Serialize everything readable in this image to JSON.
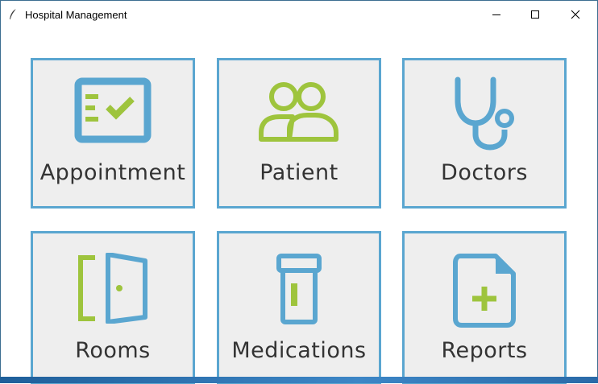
{
  "window": {
    "title": "Hospital Management",
    "controls": [
      "minimize-icon",
      "maximize-icon",
      "close-icon"
    ]
  },
  "tiles": [
    {
      "label": "Appointment",
      "icon": "appointment-checklist-icon"
    },
    {
      "label": "Patient",
      "icon": "patients-icon"
    },
    {
      "label": "Doctors",
      "icon": "stethoscope-icon"
    },
    {
      "label": "Rooms",
      "icon": "door-icon"
    },
    {
      "label": "Medications",
      "icon": "pill-bottle-icon"
    },
    {
      "label": "Reports",
      "icon": "medical-report-icon"
    }
  ],
  "colors": {
    "tile_border": "#5aa6d0",
    "tile_background": "#eeeeee",
    "icon_blue": "#5aa6d0",
    "icon_green": "#9ec43d",
    "label_text": "#333333"
  }
}
